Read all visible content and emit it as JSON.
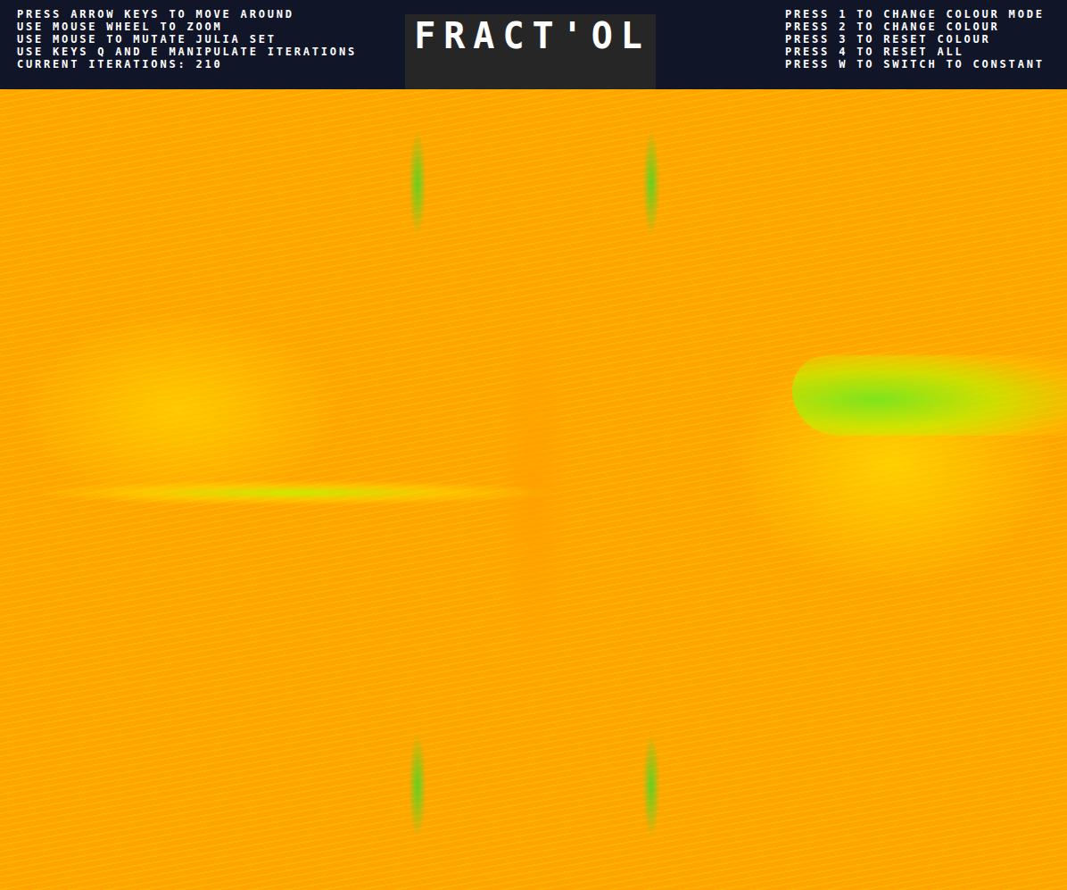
{
  "window": {
    "title": "FRACT'OL"
  },
  "instructions_left": [
    "PRESS ARROW KEYS TO MOVE AROUND",
    "USE MOUSE WHEEL TO ZOOM",
    "USE MOUSE TO MUTATE JULIA SET",
    "USE KEYS Q AND E MANIPULATE ITERATIONS",
    "CURRENT ITERATIONS: 210"
  ],
  "instructions_right": [
    "PRESS 1 TO CHANGE COLOUR MODE",
    "PRESS 2 TO CHANGE COLOUR",
    "PRESS 3 TO RESET COLOUR",
    "PRESS 4 TO RESET ALL",
    "PRESS W TO SWITCH TO CONSTANT"
  ]
}
